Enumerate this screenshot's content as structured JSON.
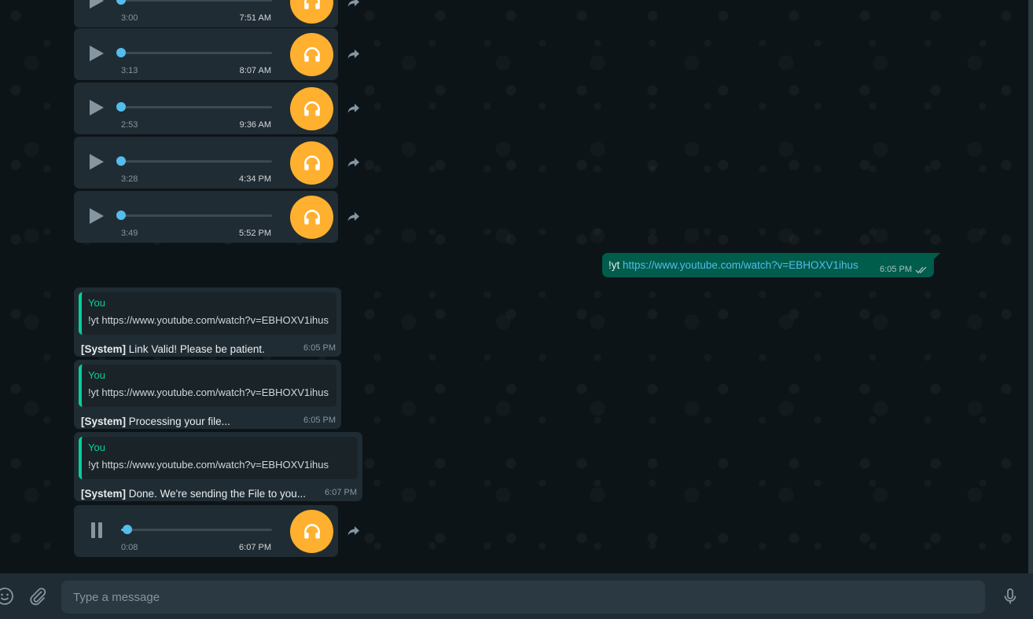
{
  "colors": {
    "wallpaper": "#0d1418",
    "bubble_in": "#202c33",
    "bubble_out": "#005c4b",
    "accent_green": "#06cf9c",
    "link_blue": "#53bdeb",
    "avatar_orange": "#ffb02e"
  },
  "audio_messages": [
    {
      "duration": "3:00",
      "time": "7:51 AM",
      "state": "play",
      "progress": 0
    },
    {
      "duration": "3:13",
      "time": "8:07 AM",
      "state": "play",
      "progress": 0
    },
    {
      "duration": "2:53",
      "time": "9:36 AM",
      "state": "play",
      "progress": 0
    },
    {
      "duration": "3:28",
      "time": "4:34 PM",
      "state": "play",
      "progress": 0
    },
    {
      "duration": "3:49",
      "time": "5:52 PM",
      "state": "play",
      "progress": 0
    },
    {
      "duration": "0:08",
      "time": "6:07 PM",
      "state": "pause",
      "progress": 0.04
    }
  ],
  "outgoing": {
    "command": "!yt",
    "link": "https://www.youtube.com/watch?v=EBHOXV1ihus",
    "time": "6:05 PM",
    "status_icon": "double-check-icon"
  },
  "quoted_messages": [
    {
      "quote_author": "You",
      "quote_text": "!yt https://www.youtube.com/watch?v=EBHOXV1ihus",
      "label": "[System]",
      "text": "Link Valid! Please be patient.",
      "time": "6:05 PM"
    },
    {
      "quote_author": "You",
      "quote_text": "!yt https://www.youtube.com/watch?v=EBHOXV1ihus",
      "label": "[System]",
      "text": "Processing your file...",
      "time": "6:05 PM"
    },
    {
      "quote_author": "You",
      "quote_text": "!yt https://www.youtube.com/watch?v=EBHOXV1ihus",
      "label": "[System]",
      "text": "Done. We're sending the File to you...",
      "time": "6:07 PM"
    }
  ],
  "composer": {
    "placeholder": "Type a message"
  }
}
